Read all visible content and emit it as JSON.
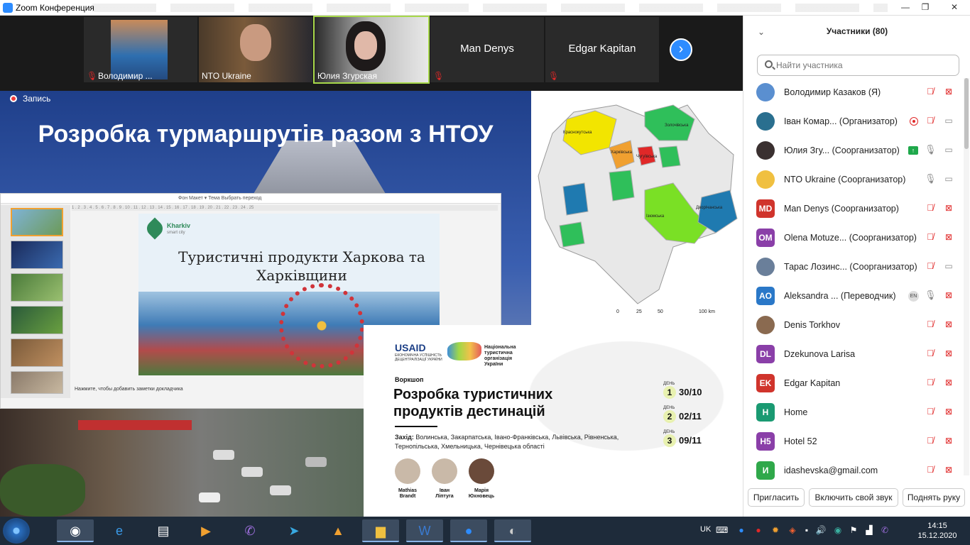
{
  "window": {
    "title": "Zoom Конференция",
    "controls": [
      "—",
      "❐",
      "✕"
    ]
  },
  "strip": {
    "tiles": [
      {
        "name": "Володимир ...",
        "muted": true
      },
      {
        "name": "NTO Ukraine",
        "muted": false
      },
      {
        "name": "Юлия Згурская",
        "muted": false,
        "active": true
      },
      {
        "name": "Man Denys",
        "muted": true
      },
      {
        "name": "Edgar Kapitan",
        "muted": true
      }
    ],
    "next_icon": "chevron-right-icon"
  },
  "share": {
    "recording_label": "Запись",
    "heading": "Розробка турмаршрутів разом з НТОУ",
    "ppt": {
      "menu": "Фон     Макет ▾     Тема     Выбрать переход",
      "ruler": "1 . 2 . 3 . 4 . 5 . 6 . 7 . 8 . 9 . 10 . 11 . 12 . 13 . 14 . 15 . 16 . 17 . 18 . 19 . 20 . 21 . 22 . 23 . 24 . 25",
      "slide_logo": "Kharkiv",
      "slide_logo_sub": "smart city",
      "slide_title": "Туристичні продукти Харкова та Харківщини",
      "notes": "Нажмите, чтобы добавить заметки докладчика"
    },
    "map": {
      "labels": [
        "Краснокутська",
        "Золочівська",
        "Харківська",
        "Чугуївська",
        "Ізюмська",
        "Дворічанська"
      ],
      "scale": [
        "0",
        "25",
        "50",
        "100 km"
      ]
    },
    "poster": {
      "usaid": "USAID",
      "usaid_sub": "ЕКОНОМІЧНА УСПІШНІСТЬ ДЕЦЕНТРАЛІЗАЦІЇ УКРАЇНИ",
      "nto": "Національна туристична організація України",
      "workshop": "Воркшоп",
      "title": "Розробка туристичних продуктів дестинацій",
      "zahid_label": "Захід:",
      "zahid_text": "Волинська, Закарпатська, Івано-Франківська, Львівська, Рівненська, Тернопільська, Хмельницька, Чернівецька області",
      "days": [
        {
          "label": "ДЕНЬ",
          "num": "1",
          "date": "30/10"
        },
        {
          "label": "ДЕНЬ",
          "num": "2",
          "date": "02/11"
        },
        {
          "label": "ДЕНЬ",
          "num": "3",
          "date": "09/11"
        }
      ],
      "speakers": [
        "Mathias Brandt",
        "Іван Ліптуга",
        "Марія Юхновець"
      ]
    }
  },
  "panel": {
    "title": "Участники (80)",
    "search_placeholder": "Найти участника",
    "participants": [
      {
        "initials": "",
        "name": "Володимир Казаков (Я)",
        "color": "#5a8fd0",
        "mic": "muted",
        "cam": "off"
      },
      {
        "initials": "",
        "name": "Іван Комар...  (Организатор)",
        "color": "#2a6f8f",
        "mic": "muted",
        "cam": "on",
        "badge": "rec"
      },
      {
        "initials": "",
        "name": "Юлия Згу...  (Соорганизатор)",
        "color": "#3a3030",
        "mic": "on",
        "cam": "on",
        "badge": "up"
      },
      {
        "initials": "",
        "name": "NTO Ukraine (Соорганизатор)",
        "color": "#f0c040",
        "mic": "on",
        "cam": "on"
      },
      {
        "initials": "MD",
        "name": "Man Denys (Соорганизатор)",
        "color": "#d0342c",
        "mic": "muted",
        "cam": "off"
      },
      {
        "initials": "OM",
        "name": "Olena Motuze... (Соорганизатор)",
        "color": "#8a3fa8",
        "mic": "muted",
        "cam": "off"
      },
      {
        "initials": "",
        "name": "Тарас Лозинс... (Соорганизатор)",
        "color": "#6a7f9a",
        "mic": "muted",
        "cam": "on"
      },
      {
        "initials": "AO",
        "name": "Aleksandra ...     (Переводчик)",
        "color": "#2a78c8",
        "mic": "on",
        "cam": "off",
        "badge": "EN"
      },
      {
        "initials": "",
        "name": "Denis Torkhov",
        "color": "#8a6a50",
        "mic": "muted",
        "cam": "off"
      },
      {
        "initials": "DL",
        "name": "Dzekunova Larisa",
        "color": "#8a3fa8",
        "mic": "muted",
        "cam": "off"
      },
      {
        "initials": "EK",
        "name": "Edgar Kapitan",
        "color": "#d0342c",
        "mic": "muted",
        "cam": "off"
      },
      {
        "initials": "H",
        "name": "Home",
        "color": "#1a9a72",
        "mic": "muted",
        "cam": "off"
      },
      {
        "initials": "H5",
        "name": "Hotel 52",
        "color": "#8a3fa8",
        "mic": "muted",
        "cam": "off"
      },
      {
        "initials": "И",
        "name": "idashevska@gmail.com",
        "color": "#2fa84a",
        "mic": "muted",
        "cam": "off"
      }
    ],
    "buttons": [
      "Пригласить",
      "Включить свой звук",
      "Поднять руку"
    ]
  },
  "taskbar": {
    "apps": [
      "chrome-icon",
      "ie-icon",
      "files-icon",
      "media-icon",
      "viber-icon",
      "telegram-icon",
      "vlc-icon",
      "explorer-icon",
      "word-icon",
      "zoom-icon",
      "earth-pro-icon"
    ],
    "lang": "UK",
    "time": "14:15",
    "date": "15.12.2020"
  }
}
